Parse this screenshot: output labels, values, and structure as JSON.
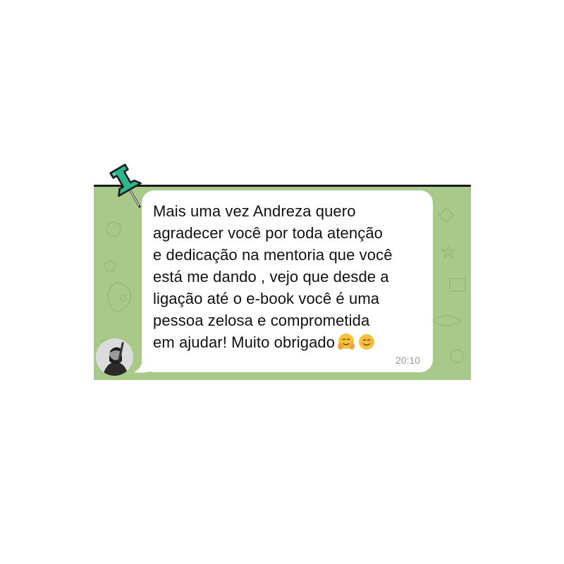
{
  "message": {
    "lines": [
      "Mais uma vez Andreza quero",
      "agradecer você por toda atenção",
      "e dedicação na mentoria que você",
      "está me dando , vejo que desde a",
      "ligação até o e-book você é uma",
      "pessoa zelosa e comprometida",
      "em ajudar! Muito obrigado"
    ],
    "emojis": [
      "hugging-face",
      "smiling-face"
    ],
    "time": "20:10"
  },
  "colors": {
    "chat_background": "#a9c98a",
    "bubble": "#ffffff",
    "pin": "#2fb58c",
    "timestamp": "#9a9a9a"
  },
  "icons": {
    "pin": "push-pin-icon",
    "avatar": "user-avatar"
  }
}
